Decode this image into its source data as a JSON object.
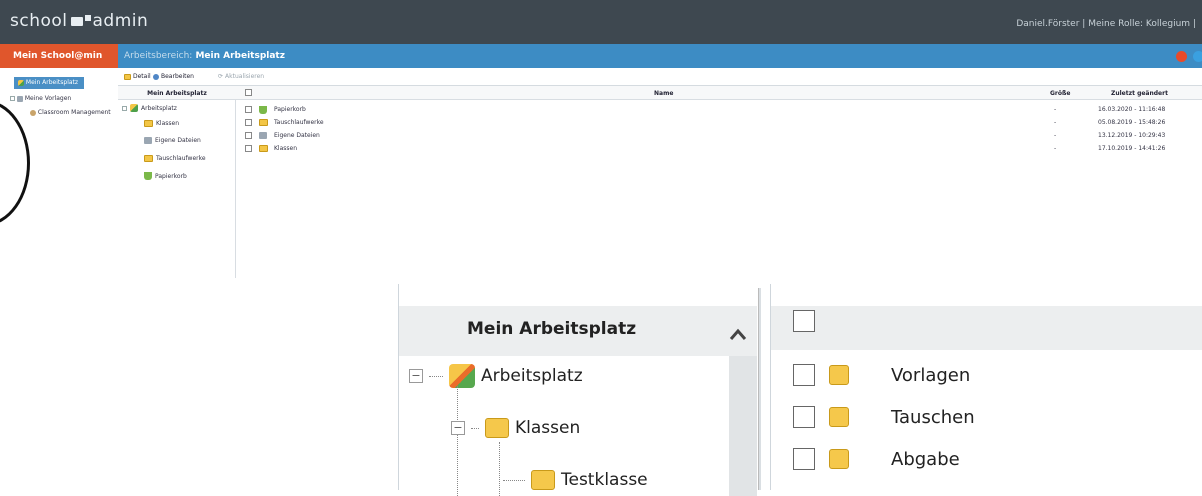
{
  "app": {
    "brand_prefix": "school",
    "brand_suffix": "admin"
  },
  "user": {
    "name": "Daniel.Förster",
    "separator": "|",
    "role_label": "Meine Rolle: Kollegium",
    "trail": "|"
  },
  "nav": {
    "my_schooladmin": "Mein School@min",
    "breadcrumb_label": "Arbeitsbereich:",
    "breadcrumb_value": "Mein Arbeitsplatz"
  },
  "left_menu": {
    "items": [
      "Mein Arbeitsplatz",
      "Meine Vorlagen",
      "Classroom Management"
    ]
  },
  "toolbar": {
    "detail": "Detail",
    "edit": "Bearbeiten",
    "refresh": "Aktualisieren"
  },
  "tree": {
    "header": "Mein Arbeitsplatz",
    "root": "Arbeitsplatz",
    "children": [
      "Klassen",
      "Eigene Dateien",
      "Tauschlaufwerke",
      "Papierkorb"
    ]
  },
  "table": {
    "columns": {
      "name": "Name",
      "size": "Größe",
      "modified": "Zuletzt geändert"
    },
    "rows": [
      {
        "name": "Papierkorb",
        "size": "-",
        "modified": "16.03.2020 - 11:16:48"
      },
      {
        "name": "Tauschlaufwerke",
        "size": "-",
        "modified": "05.08.2019 - 15:48:26"
      },
      {
        "name": "Eigene Dateien",
        "size": "-",
        "modified": "13.12.2019 - 10:29:43"
      },
      {
        "name": "Klassen",
        "size": "-",
        "modified": "17.10.2019 - 14:41:26"
      }
    ]
  },
  "zoom": {
    "header": "Mein Arbeitsplatz",
    "tree": [
      "Arbeitsplatz",
      "Klassen",
      "Testklasse"
    ],
    "files": [
      "Vorlagen",
      "Tauschen",
      "Abgabe"
    ]
  },
  "colors": {
    "topbar": "#3e4850",
    "navbar": "#3d8cc4",
    "accent": "#e0562c"
  }
}
